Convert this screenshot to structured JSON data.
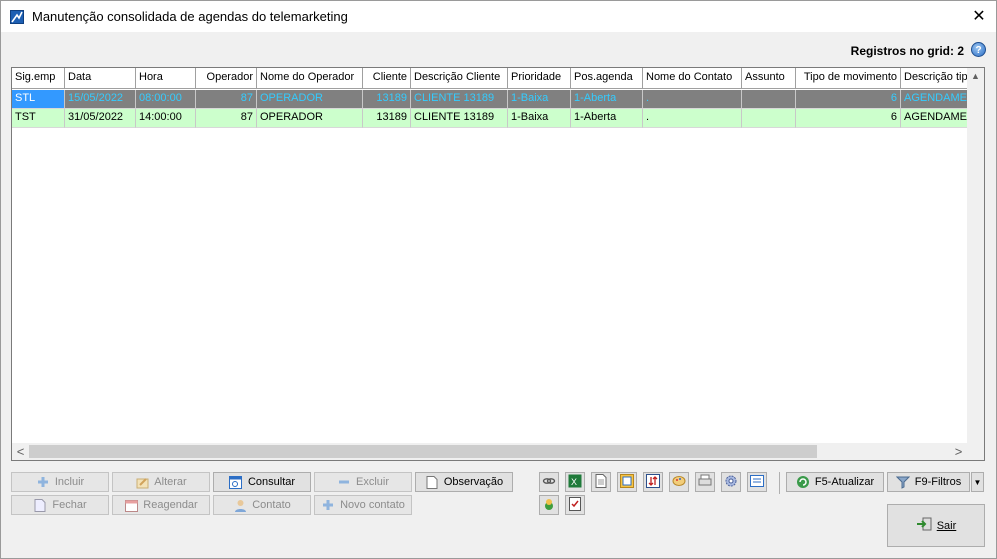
{
  "window": {
    "title": "Manutenção consolidada de agendas do telemarketing",
    "close_glyph": "✕"
  },
  "grid_info": {
    "count_label": "Registros no grid: 2",
    "help_glyph": "?"
  },
  "grid": {
    "columns": [
      "Sig.emp",
      "Data",
      "Hora",
      "Operador",
      "Nome do Operador",
      "Cliente",
      "Descrição Cliente",
      "Prioridade",
      "Pos.agenda",
      "Nome do Contato",
      "Assunto",
      "Tipo de movimento",
      "Descrição tipo"
    ],
    "rows": [
      [
        "STL",
        "15/05/2022",
        "08:00:00",
        "87",
        "OPERADOR",
        "13189",
        "CLIENTE 13189",
        "1-Baixa",
        "1-Aberta",
        ".",
        "",
        "6",
        "AGENDAMENTO"
      ],
      [
        "TST",
        "31/05/2022",
        "14:00:00",
        "87",
        "OPERADOR",
        "13189",
        "CLIENTE 13189",
        "1-Baixa",
        "1-Aberta",
        ".",
        "",
        "6",
        "AGENDAMENTO"
      ]
    ],
    "scroll_left": "<",
    "scroll_right": ">",
    "scroll_up": "▲",
    "scroll_down": "▼"
  },
  "buttons": {
    "incluir": "Incluir",
    "alterar": "Alterar",
    "consultar": "Consultar",
    "excluir": "Excluir",
    "observacao": "Observação",
    "fechar": "Fechar",
    "reagendar": "Reagendar",
    "contato": "Contato",
    "novo_contato": "Novo contato",
    "atualizar": "F5-Atualizar",
    "filtros": "F9-Filtros",
    "filtros_dropdown": "▼",
    "sair": "Sair"
  },
  "icons": {
    "toolbar": [
      "link-icon",
      "excel-icon",
      "document-icon",
      "report-icon",
      "sort-icon",
      "palette-icon",
      "print-icon",
      "settings-icon",
      "layout-icon",
      "money-icon",
      "checklist-icon"
    ]
  },
  "colors": {
    "selected_row_bg": "#808080",
    "selected_row_text": "#33ccff",
    "selected_cell_bg": "#3399ff",
    "normal_row_bg": "#ccffcc"
  }
}
